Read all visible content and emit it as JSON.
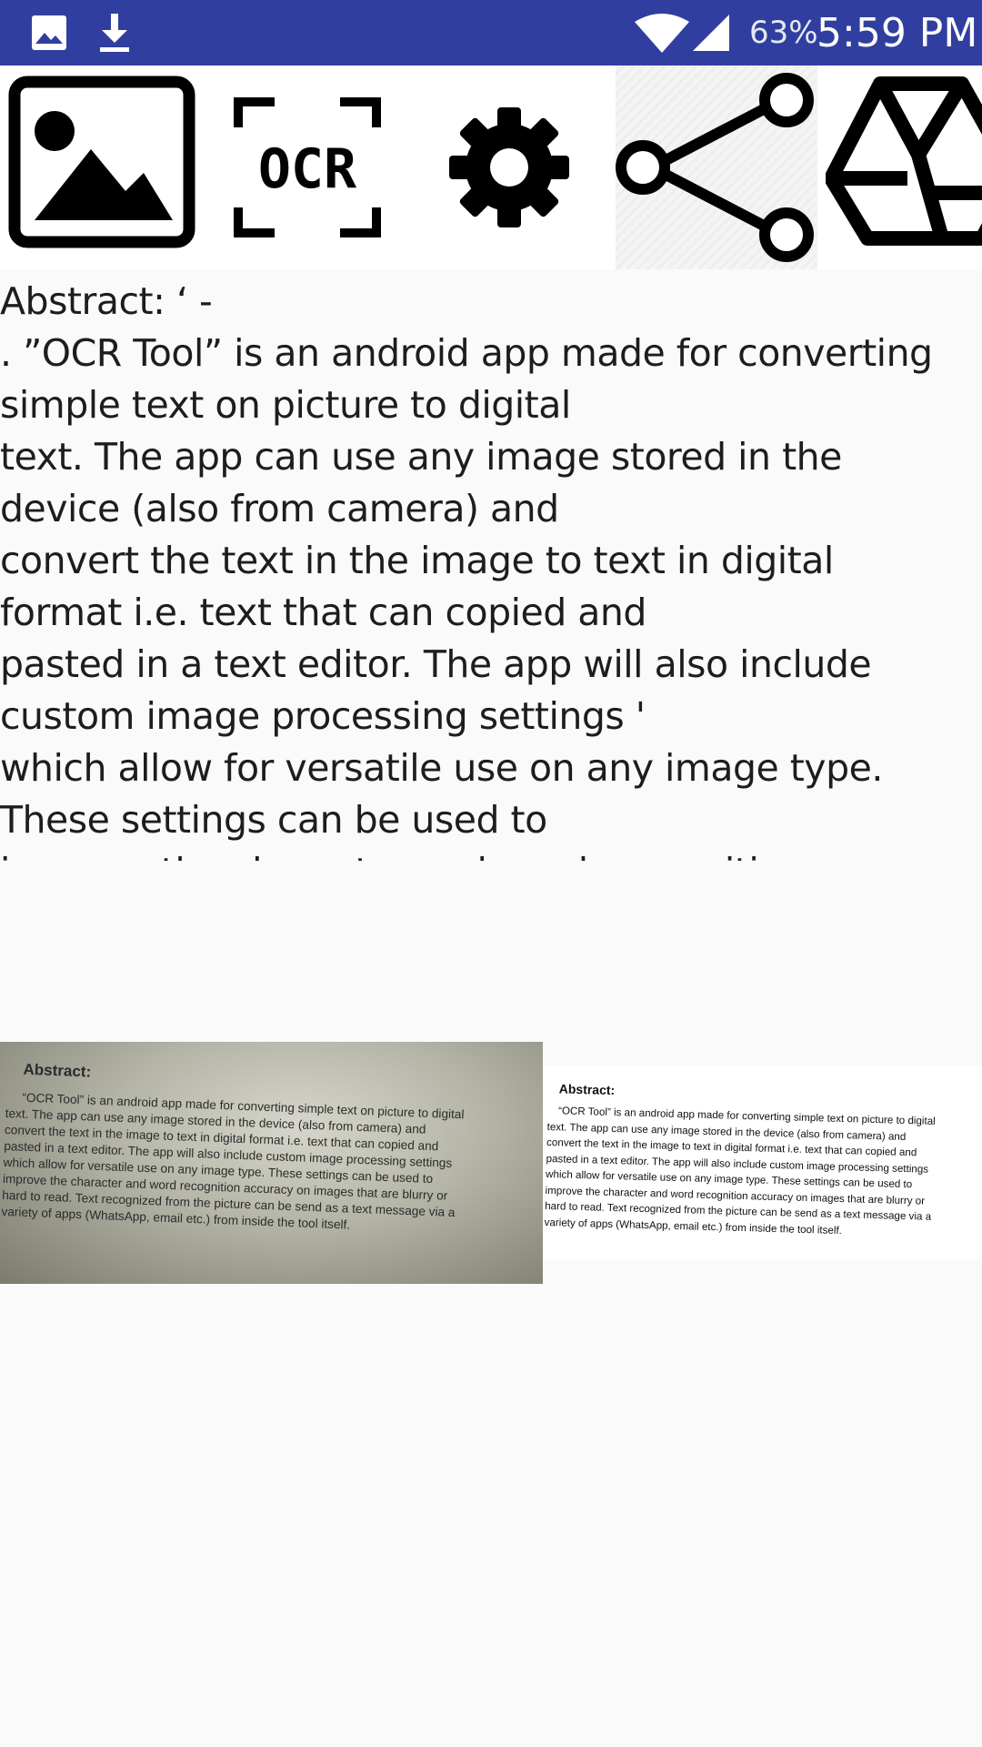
{
  "status_bar": {
    "battery_percent": "63%",
    "time": "5:59 PM",
    "icons": [
      "gallery-icon",
      "download-icon",
      "wifi-icon",
      "signal-icon"
    ],
    "background_color": "#303f9f"
  },
  "toolbar": {
    "buttons": [
      {
        "name": "gallery-button",
        "icon": "image-icon"
      },
      {
        "name": "ocr-button",
        "icon": "ocr-scan-icon",
        "label": "OCR"
      },
      {
        "name": "settings-button",
        "icon": "gear-icon"
      },
      {
        "name": "share-button",
        "icon": "share-icon"
      },
      {
        "name": "drive-button",
        "icon": "drive-icon"
      }
    ]
  },
  "result_text": {
    "lines": [
      "Abstract: ‘ -",
      ". ”OCR Tool” is an android app made for converting",
      "simple text on picture to digital",
      "text. The app can use any image stored in the",
      "device (also from camera) and",
      "convert the text in the image to text in digital",
      "format i.e. text that can copied and",
      "pasted in a text editor. The app will also include",
      "custom image processing settings '",
      "which allow for versatile use on any image type.",
      "These settings can be used to",
      "improve the character and word recognition"
    ]
  },
  "source_image": {
    "title": "Abstract:",
    "lines": [
      "“OCR Tool” is an android app made for converting simple text on picture to digital",
      "text. The app can use any image stored in the device (also from camera) and",
      "convert the text in the image to text in digital format i.e. text that can copied and",
      "pasted in a text editor. The app will also include custom image processing settings",
      "which allow for versatile use on any image type. These settings can be used to",
      "improve the character and word recognition accuracy on images that are blurry or",
      "hard to read. Text recognized from the picture can be send as a text message via a",
      "variety of apps (WhatsApp, email etc.) from inside the tool itself."
    ]
  },
  "processed_image": {
    "title": "Abstract:",
    "lines": [
      "“OCR Tool” is an android app made for converting simple text on picture to digital",
      "text. The app can use any image stored in the device (also from camera) and",
      "convert the text in the image to text in digital format i.e. text that can copied and",
      "pasted in a text editor. The app will also include custom image processing settings",
      "which allow for versatile use on any image type. These settings can be used to",
      "improve the character and word recognition accuracy on images that are blurry or",
      "hard to read. Text recognized from the picture can be send as a text message via a",
      "variety of apps (WhatsApp, email etc.) from inside the tool itself."
    ]
  }
}
